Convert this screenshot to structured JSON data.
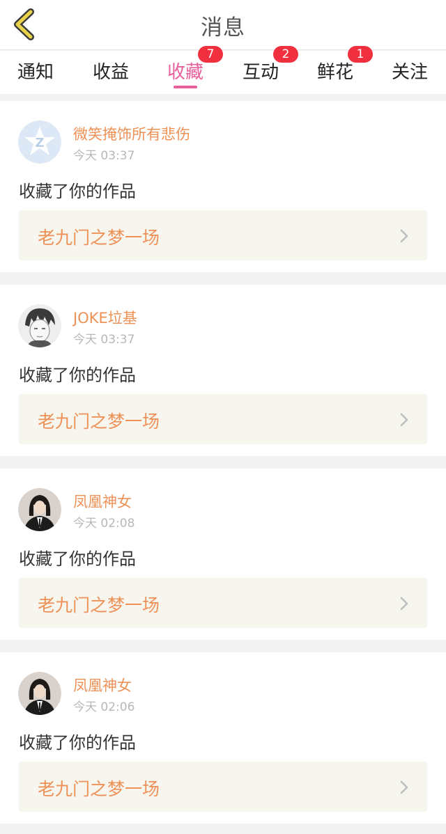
{
  "header": {
    "title": "消息",
    "back_icon": "chevron-left-icon",
    "back_icon_color": "#e8d34a"
  },
  "tabs": [
    {
      "label": "通知",
      "badge": null,
      "active": false
    },
    {
      "label": "收益",
      "badge": null,
      "active": false
    },
    {
      "label": "收藏",
      "badge": "7",
      "active": true
    },
    {
      "label": "互动",
      "badge": "2",
      "active": false
    },
    {
      "label": "鲜花",
      "badge": "1",
      "active": false
    },
    {
      "label": "关注",
      "badge": null,
      "active": false
    }
  ],
  "colors": {
    "accent": "#e8609b",
    "badge": "#f0303f",
    "username": "#ee9156",
    "work_box_bg": "#f6f5ee"
  },
  "messages": [
    {
      "username": "微笑掩饰所有悲伤",
      "time": "今天 03:37",
      "action": "收藏了你的作品",
      "work_title": "老九门之梦一场",
      "avatar": "default-avatar-icon"
    },
    {
      "username": "JOKE垃基",
      "time": "今天 03:37",
      "action": "收藏了你的作品",
      "work_title": "老九门之梦一场",
      "avatar": "sketch-portrait"
    },
    {
      "username": "凤凰神女",
      "time": "今天 02:08",
      "action": "收藏了你的作品",
      "work_title": "老九门之梦一场",
      "avatar": "photo-portrait"
    },
    {
      "username": "凤凰神女",
      "time": "今天 02:06",
      "action": "收藏了你的作品",
      "work_title": "老九门之梦一场",
      "avatar": "photo-portrait"
    }
  ]
}
